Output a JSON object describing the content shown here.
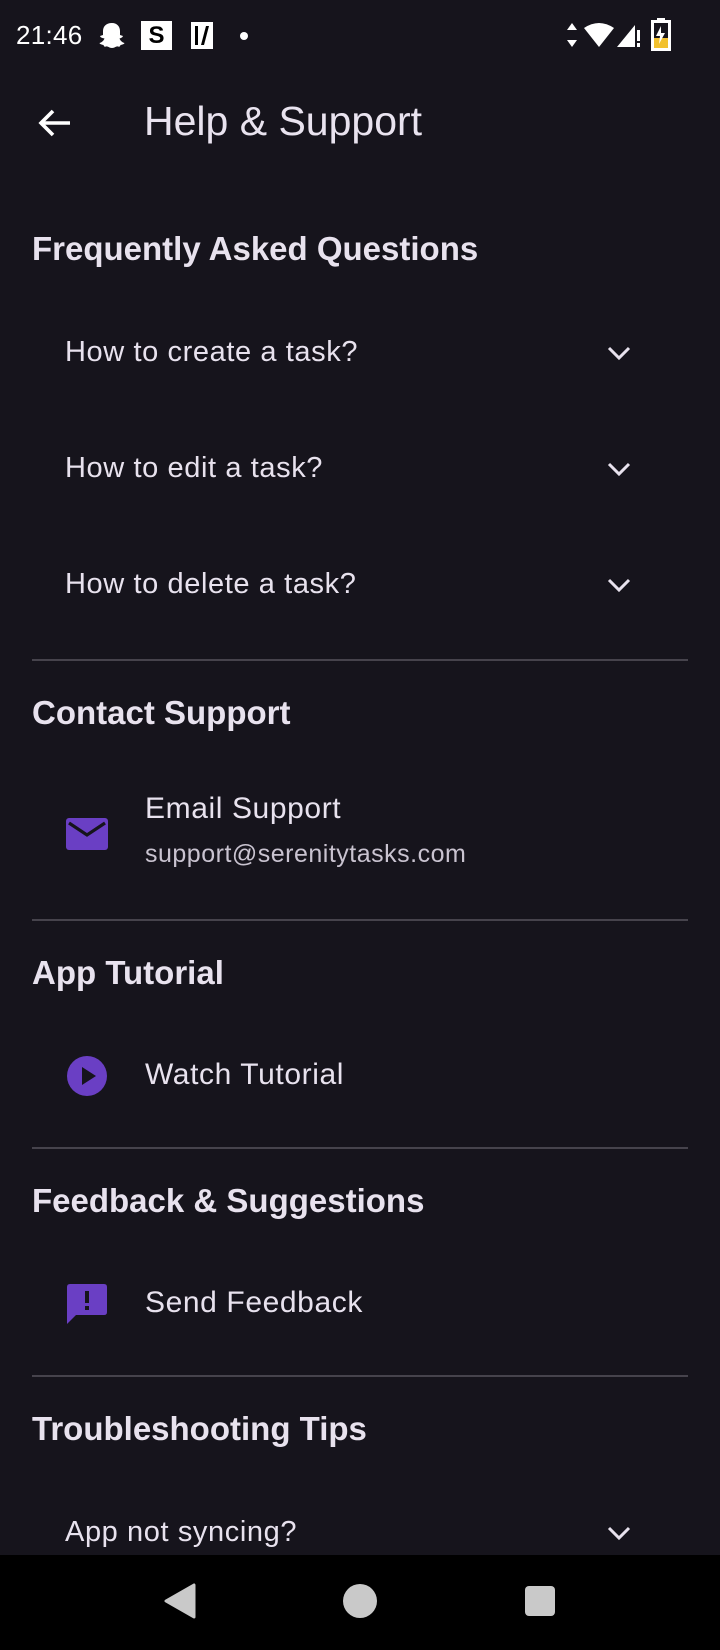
{
  "status_bar": {
    "time": "21:46",
    "s_badge": "S",
    "icons": [
      "snapchat-ghost-icon",
      "s-app-icon",
      "slash-app-icon",
      "dot-icon",
      "data-arrows-icon",
      "wifi-icon",
      "signal-icon",
      "battery-charging-icon"
    ]
  },
  "header": {
    "title": "Help & Support",
    "back_icon": "arrow-left-icon"
  },
  "faq": {
    "title": "Frequently Asked Questions",
    "items": [
      {
        "question": "How to create a task?"
      },
      {
        "question": "How to edit a task?"
      },
      {
        "question": "How to delete a task?"
      }
    ]
  },
  "contact": {
    "title": "Contact Support",
    "email_label": "Email Support",
    "email_address": "support@serenitytasks.com",
    "icon": "email-icon"
  },
  "tutorial": {
    "title": "App Tutorial",
    "watch_label": "Watch Tutorial",
    "icon": "play-circle-icon"
  },
  "feedback": {
    "title": "Feedback & Suggestions",
    "send_label": "Send Feedback",
    "icon": "feedback-icon"
  },
  "troubleshooting": {
    "title": "Troubleshooting Tips",
    "items": [
      {
        "question": "App not syncing?"
      }
    ]
  },
  "colors": {
    "background": "#16141c",
    "accent": "#6a3fc4",
    "text": "#e8e2ee",
    "divider": "#46434c"
  }
}
